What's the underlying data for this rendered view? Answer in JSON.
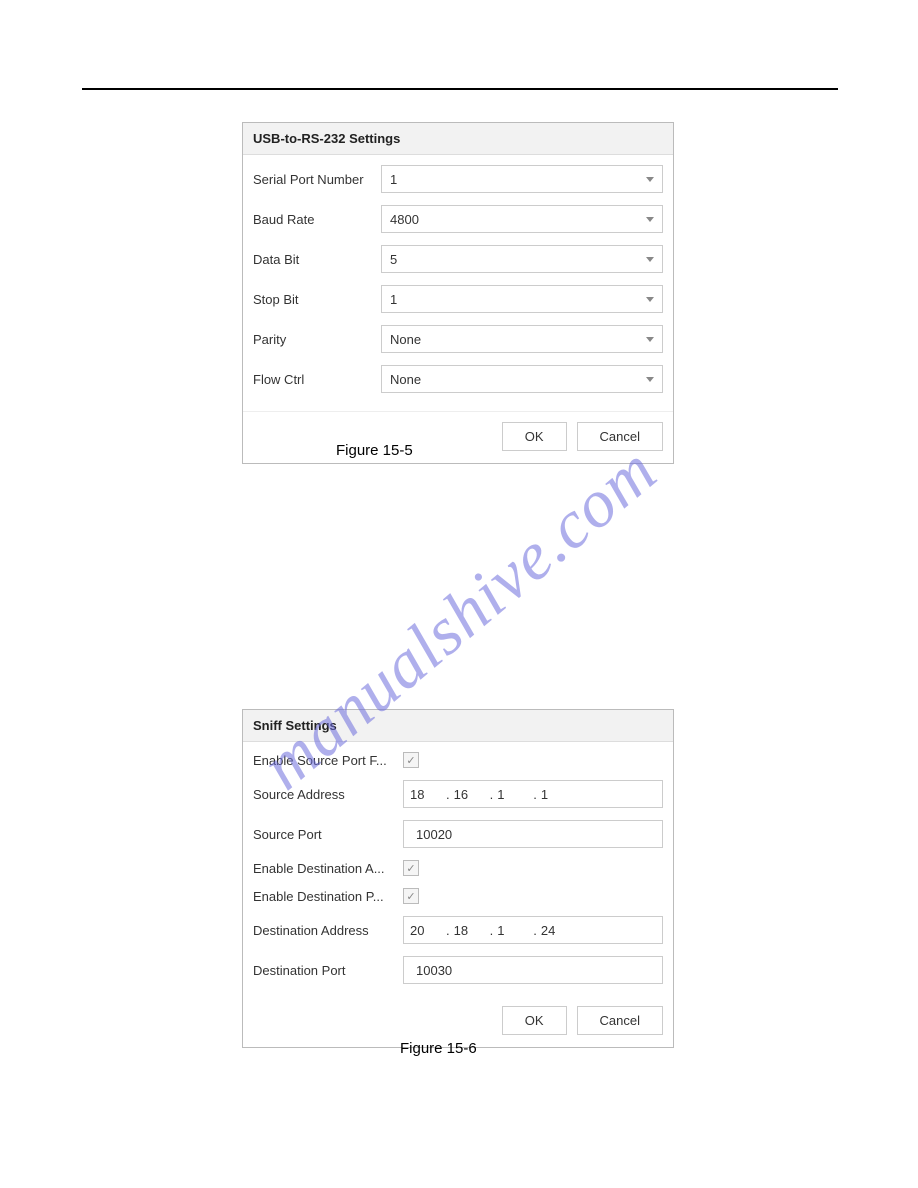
{
  "watermark": "manualshive.com",
  "panel1": {
    "title": "USB-to-RS-232 Settings",
    "rows": {
      "serial_label": "Serial Port Number",
      "serial_value": "1",
      "baud_label": "Baud Rate",
      "baud_value": "4800",
      "databit_label": "Data Bit",
      "databit_value": "5",
      "stopbit_label": "Stop Bit",
      "stopbit_value": "1",
      "parity_label": "Parity",
      "parity_value": "None",
      "flow_label": "Flow Ctrl",
      "flow_value": "None"
    },
    "ok": "OK",
    "cancel": "Cancel",
    "caption": "Figure 15-5"
  },
  "panel2": {
    "title": "Sniff Settings",
    "rows": {
      "en_src_port_label": "Enable Source Port F...",
      "src_addr_label": "Source Address",
      "src_addr": {
        "a": "18",
        "b": "16",
        "c": "1",
        "d": "1"
      },
      "src_port_label": "Source Port",
      "src_port_value": "10020",
      "en_dst_addr_label": "Enable Destination A...",
      "en_dst_port_label": "Enable Destination P...",
      "dst_addr_label": "Destination Address",
      "dst_addr": {
        "a": "20",
        "b": "18",
        "c": "1",
        "d": "24"
      },
      "dst_port_label": "Destination Port",
      "dst_port_value": "10030"
    },
    "ok": "OK",
    "cancel": "Cancel",
    "caption": "Figure 15-6"
  },
  "glyph": {
    "check": "✓",
    "dot": "."
  }
}
